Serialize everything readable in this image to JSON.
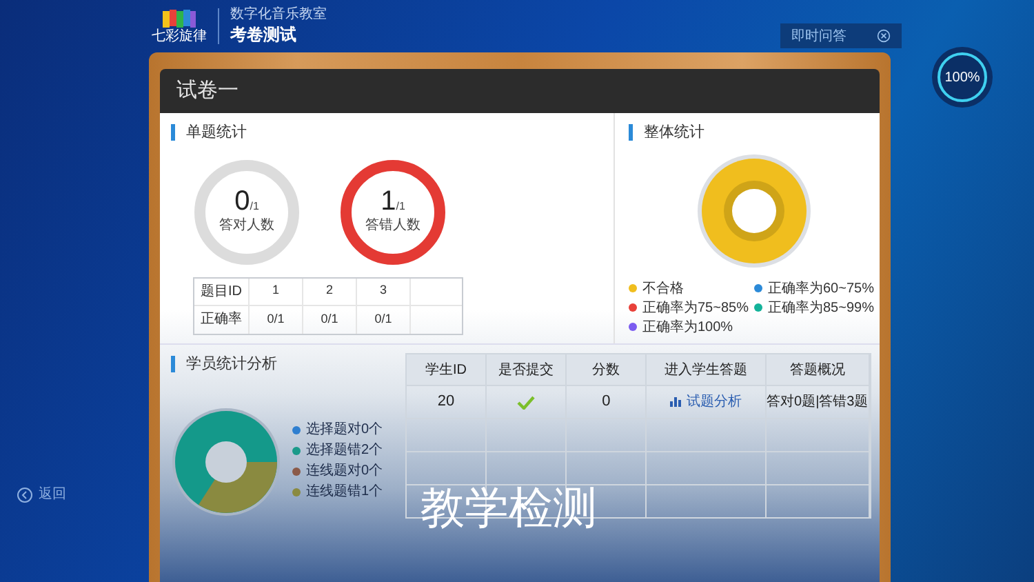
{
  "header": {
    "logo_text": "七彩旋律",
    "subtitle": "数字化音乐教室",
    "title": "考卷测试"
  },
  "quick_answer": {
    "label": "即时问答"
  },
  "progress": {
    "reading": "100%",
    "level": 1
  },
  "back": {
    "label": "返回"
  },
  "paper": {
    "title": "试卷一"
  },
  "single_stats": {
    "title": "单题统计",
    "counters": [
      {
        "kind": "correct",
        "value": "0",
        "total": "/1",
        "label": "答对人数"
      },
      {
        "kind": "wrong",
        "value": "1",
        "total": "/1",
        "label": "答错人数"
      }
    ],
    "table": [
      {
        "header": "题目ID",
        "cells": [
          "1",
          "2",
          "3"
        ]
      },
      {
        "header": "正确率",
        "cells": [
          "0/1",
          "0/1",
          "0/1"
        ]
      }
    ]
  },
  "overall_stats": {
    "title": "整体统计",
    "legend": [
      {
        "label": "不合格",
        "color": "#f0be1e"
      },
      {
        "label": "正确率为60~75%",
        "color": "#2b8ad8"
      },
      {
        "label": "正确率为75~85%",
        "color": "#e8413a"
      },
      {
        "label": "正确率为85~99%",
        "color": "#14b39a"
      },
      {
        "label": "正确率为100%",
        "color": "#7b5cf0"
      }
    ]
  },
  "student_stats": {
    "title": "学员统计分析",
    "legend": [
      {
        "label": "选择题对0个",
        "color": "#2f7fd0"
      },
      {
        "label": "选择题错2个",
        "color": "#1a9a8a"
      },
      {
        "label": "连线题对0个",
        "color": "#8b5a48"
      },
      {
        "label": "连线题错1个",
        "color": "#8a8a40"
      }
    ]
  },
  "students_table": {
    "columns": [
      "学生ID",
      "是否提交",
      "分数",
      "进入学生答题",
      "答题概况"
    ],
    "rows": [
      {
        "student_id": "20",
        "submitted": true,
        "score": "0",
        "link": "试题分析",
        "summary": "答对0题|答错3题"
      }
    ]
  },
  "caption": "教学检测"
}
